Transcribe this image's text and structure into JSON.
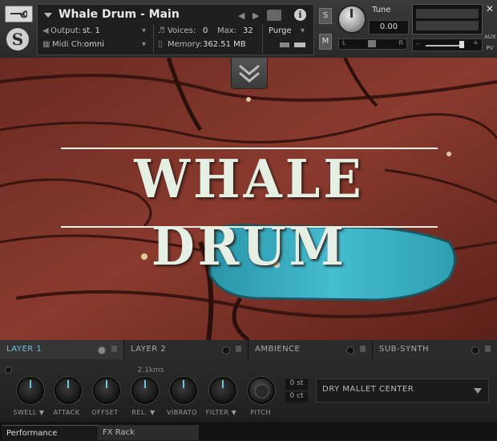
{
  "header": {
    "title": "Whale Drum - Main",
    "output_label": "Output:",
    "output_value": "st. 1",
    "voices_label": "Voices:",
    "voices_value": "0",
    "max_label": "Max:",
    "max_value": "32",
    "purge_label": "Purge",
    "midi_label": "Midi Ch:",
    "midi_value": "omni",
    "memory_label": "Memory:",
    "memory_value": "362.51 MB",
    "s_button": "S",
    "m_button": "M",
    "tune_label": "Tune",
    "tune_value": "0.00",
    "pan_left": "L",
    "pan_right": "R",
    "aux_label": "AUX",
    "pv_label": "PV"
  },
  "artwork": {
    "logo_text": "WHALE DRUM"
  },
  "tabs": [
    {
      "label": "LAYER 1",
      "active": true
    },
    {
      "label": "LAYER 2",
      "active": false
    },
    {
      "label": "AMBIENCE",
      "active": false
    },
    {
      "label": "SUB-SYNTH",
      "active": false
    }
  ],
  "controls": {
    "knobs": [
      {
        "label": "SWELL ▼"
      },
      {
        "label": "ATTACK"
      },
      {
        "label": "OFFSET"
      },
      {
        "label": "REL. ▼"
      },
      {
        "label": "VIBRATO"
      },
      {
        "label": "FILTER ▼"
      },
      {
        "label": "PITCH"
      }
    ],
    "rel_value": "2.1kms",
    "pitch_st": "0 st",
    "pitch_ct": "0 ct",
    "preset": "DRY MALLET CENTER"
  },
  "footer": {
    "tab1": "Performance",
    "tab2": "FX Rack"
  },
  "colors": {
    "accent": "#6cc8d8",
    "wood": "#7a3328",
    "whale": "#3fb4c6"
  }
}
